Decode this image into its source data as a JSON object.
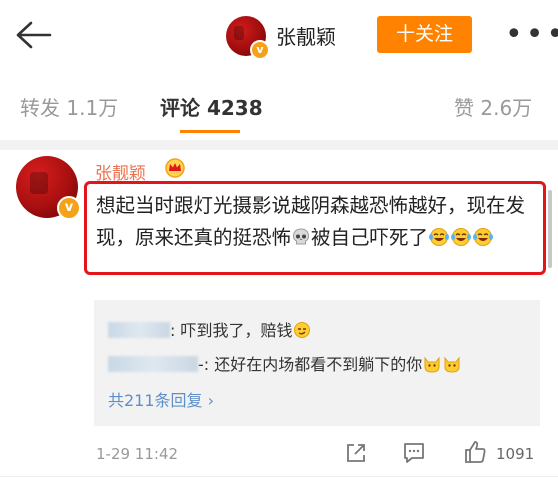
{
  "header": {
    "back_label": "",
    "user_name": "张靓颖",
    "follow_label": "十关注",
    "more_label": "•••"
  },
  "tabs": {
    "repost": "转发 1.1万",
    "comment": "评论 4238",
    "like": "赞 2.6万"
  },
  "comment": {
    "author": "张靓颖",
    "text_part1": "想起当时跟灯光摄影说越阴森越恐怖越好，现在发现，原来还真的挺恐怖",
    "text_part2": "被自己吓死了",
    "time": "1-29 11:42",
    "likes": "1091"
  },
  "replies": {
    "items": [
      {
        "name": "",
        "text": ": 吓到我了，赔钱"
      },
      {
        "name": "",
        "text": "-: 还好在内场都看不到躺下的你"
      }
    ],
    "more_label": "共211条回复 ›"
  },
  "colors": {
    "accent": "#ff8200",
    "author": "#eb7350",
    "highlight_border": "#e5141a",
    "link": "#5f8fc9"
  }
}
